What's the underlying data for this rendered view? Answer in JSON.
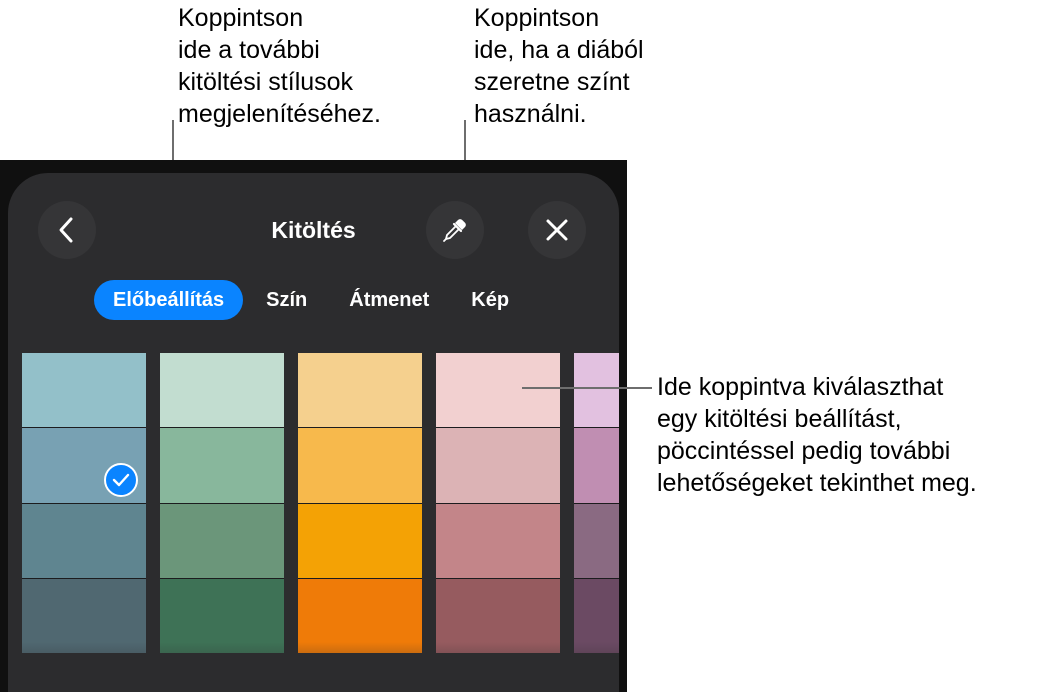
{
  "callouts": {
    "styles": "Koppintson\nide a további\nkitöltési stílusok\nmegjelenítéséhez.",
    "eyedropper": "Koppintson\nide, ha a diából\nszeretne színt\nhasználni.",
    "swatches": "Ide koppintva kiválaszthat\negy kitöltési beállítást,\npöccintéssel pedig további\nlehetőségeket tekinthet meg."
  },
  "header": {
    "title": "Kitöltés",
    "back_icon": "chevron-left-icon",
    "eyedropper_icon": "eyedropper-icon",
    "close_icon": "close-icon"
  },
  "tabs": [
    {
      "label": "Előbeállítás",
      "active": true
    },
    {
      "label": "Szín",
      "active": false
    },
    {
      "label": "Átmenet",
      "active": false
    },
    {
      "label": "Kép",
      "active": false
    }
  ],
  "swatches": [
    {
      "colors": [
        "#93c0c9",
        "#78a1b3",
        "#5f8590",
        "#506871"
      ],
      "selected_index": 1
    },
    {
      "colors": [
        "#c2ddd0",
        "#88b79c",
        "#6b967a",
        "#3e7256"
      ]
    },
    {
      "colors": [
        "#f5d08e",
        "#f7b94c",
        "#f4a205",
        "#ef7b08"
      ]
    },
    {
      "colors": [
        "#f2d0d0",
        "#dcb3b5",
        "#c38589",
        "#965b5f"
      ]
    },
    {
      "colors": [
        "#e2c1e0",
        "#c08eb2",
        "#8a6a82",
        "#6b4a63"
      ]
    }
  ],
  "accent_color": "#0a84ff"
}
